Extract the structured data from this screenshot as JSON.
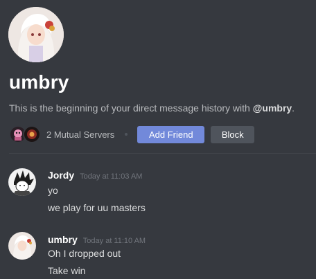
{
  "profile": {
    "username": "umbry",
    "intro_prefix": "This is the beginning of your direct message history with ",
    "intro_mention": "@umbry",
    "intro_suffix": "."
  },
  "mutual": {
    "servers_label": "2 Mutual Servers",
    "add_friend_label": "Add Friend",
    "block_label": "Block"
  },
  "messages": [
    {
      "author": "Jordy",
      "timestamp": "Today at 11:03 AM",
      "lines": [
        "yo",
        "we play for uu masters"
      ]
    },
    {
      "author": "umbry",
      "timestamp": "Today at 11:10 AM",
      "lines": [
        "Oh I dropped out",
        "Take win"
      ]
    }
  ],
  "colors": {
    "background": "#36393f",
    "accent": "#7289da",
    "secondary_button": "#4f545c"
  }
}
